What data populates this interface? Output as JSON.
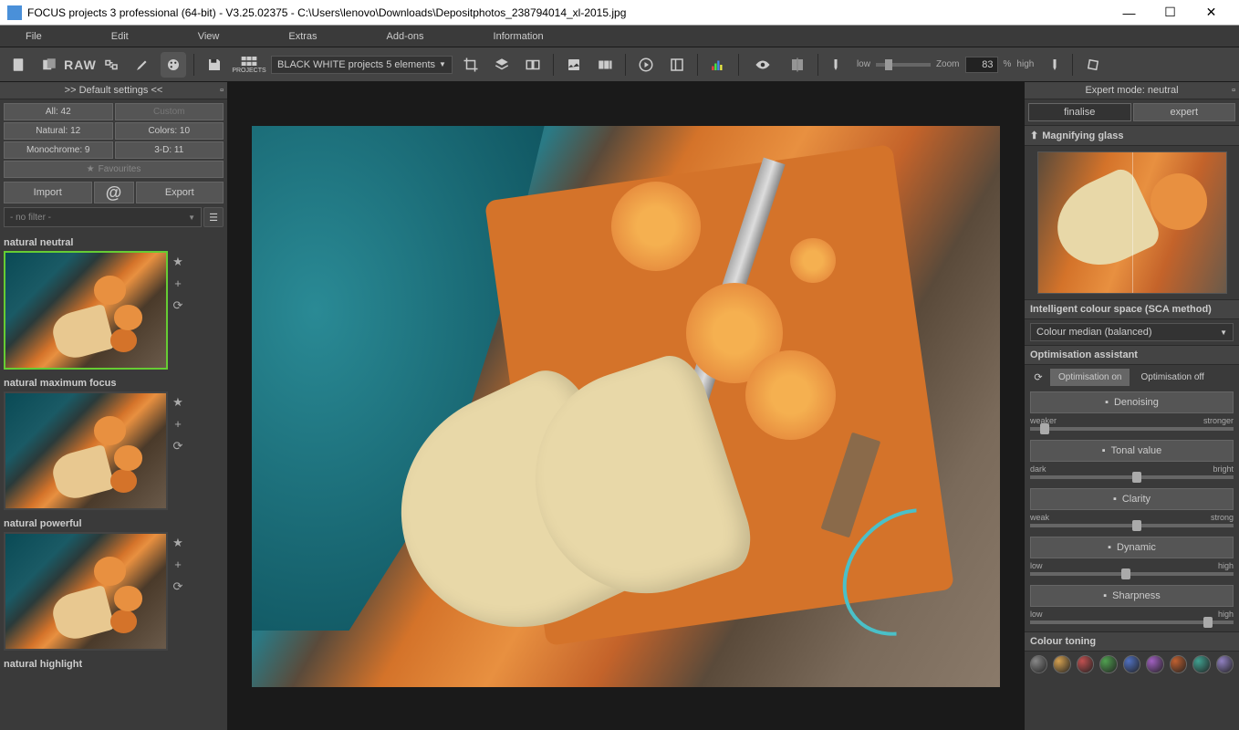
{
  "titlebar": {
    "text": "FOCUS projects 3 professional (64-bit) - V3.25.02375 - C:\\Users\\lenovo\\Downloads\\Depositphotos_238794014_xl-2015.jpg"
  },
  "menu": {
    "file": "File",
    "edit": "Edit",
    "view": "View",
    "extras": "Extras",
    "addons": "Add-ons",
    "information": "Information"
  },
  "toolbar": {
    "raw": "RAW",
    "projects_label": "PROJECTS",
    "preset_dropdown": "BLACK WHITE projects 5 elements",
    "zoom_low": "low",
    "zoom_label": "Zoom",
    "zoom_value": "83",
    "zoom_pct": "%",
    "zoom_high": "high"
  },
  "left": {
    "header": ">> Default settings <<",
    "cat_all": "All: 42",
    "cat_custom": "Custom",
    "cat_natural": "Natural: 12",
    "cat_colors": "Colors: 10",
    "cat_mono": "Monochrome: 9",
    "cat_3d": "3-D: 11",
    "favourites": "Favourites",
    "import": "Import",
    "export": "Export",
    "no_filter": "- no filter -",
    "presets": [
      {
        "label": "natural neutral",
        "selected": true
      },
      {
        "label": "natural maximum focus",
        "selected": false
      },
      {
        "label": "natural powerful",
        "selected": false
      },
      {
        "label": "natural highlight",
        "selected": false
      }
    ]
  },
  "right": {
    "header": "Expert mode: neutral",
    "tab_finalise": "finalise",
    "tab_expert": "expert",
    "magnifying": "Magnifying glass",
    "sca_header": "Intelligent colour space (SCA method)",
    "sca_value": "Colour median (balanced)",
    "opt_header": "Optimisation assistant",
    "opt_on": "Optimisation on",
    "opt_off": "Optimisation off",
    "adjustments": [
      {
        "name": "Denoising",
        "left": "weaker",
        "right": "stronger",
        "pos": 5
      },
      {
        "name": "Tonal value",
        "left": "dark",
        "right": "bright",
        "pos": 50
      },
      {
        "name": "Clarity",
        "left": "weak",
        "right": "strong",
        "pos": 50
      },
      {
        "name": "Dynamic",
        "left": "low",
        "right": "high",
        "pos": 45
      },
      {
        "name": "Sharpness",
        "left": "low",
        "right": "high",
        "pos": 85
      }
    ],
    "colour_toning": "Colour toning",
    "tones": [
      "#888888",
      "#d4a050",
      "#c05050",
      "#50a050",
      "#5070c0",
      "#a060c0",
      "#c06030",
      "#40a090",
      "#9080c0"
    ]
  }
}
